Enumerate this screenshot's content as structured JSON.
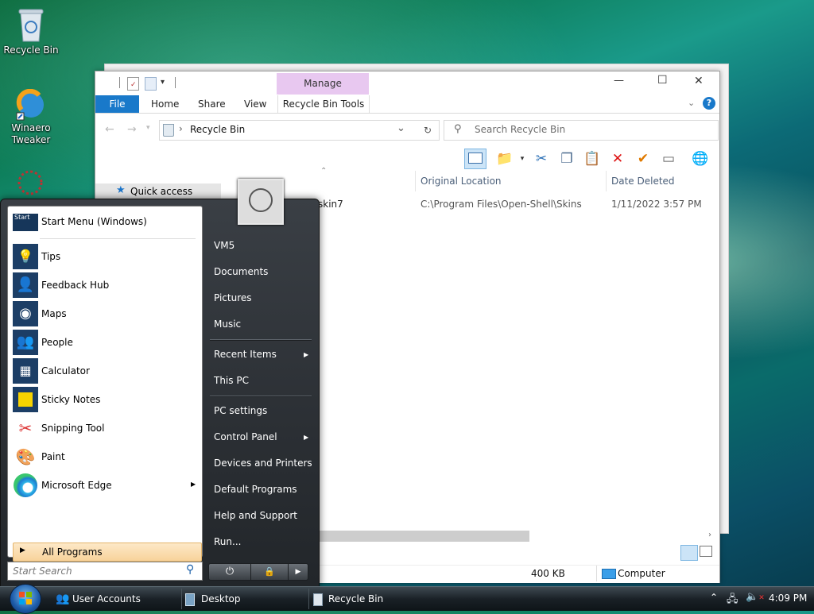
{
  "desktop": {
    "icons": [
      {
        "label": "Recycle Bin"
      },
      {
        "label": "Winaero\nTweaker"
      }
    ]
  },
  "explorer": {
    "quick_access_toolbar": [
      "properties",
      "new folder",
      "customize"
    ],
    "manage_tab": "Manage",
    "tabs": {
      "file": "File",
      "home": "Home",
      "share": "Share",
      "view": "View",
      "recycle_bin_tools": "Recycle Bin Tools"
    },
    "window_buttons": {
      "minimize": "—",
      "maximize": "☐",
      "close": "✕"
    },
    "address": {
      "path": "Recycle Bin",
      "separator": "›"
    },
    "search": {
      "placeholder": "Search Recycle Bin"
    },
    "columns": {
      "original_location": "Original Location",
      "date_deleted": "Date Deleted"
    },
    "rows": [
      {
        "name": "skin7",
        "original_location": "C:\\Program Files\\Open-Shell\\Skins",
        "date_deleted": "1/11/2022 3:57 PM"
      }
    ],
    "nav_pane": {
      "quick_access": "Quick access"
    },
    "status": {
      "size": "400 KB",
      "location": "Computer"
    }
  },
  "start_menu": {
    "pinned": [
      {
        "label": "Start Menu (Windows)",
        "icon": "start-menu-icon"
      },
      {
        "label": "Tips",
        "icon": "lightbulb-icon"
      },
      {
        "label": "Feedback Hub",
        "icon": "feedback-hub-icon"
      },
      {
        "label": "Maps",
        "icon": "maps-icon"
      },
      {
        "label": "People",
        "icon": "people-icon"
      },
      {
        "label": "Calculator",
        "icon": "calculator-icon"
      },
      {
        "label": "Sticky Notes",
        "icon": "sticky-notes-icon"
      },
      {
        "label": "Snipping Tool",
        "icon": "snipping-tool-icon"
      },
      {
        "label": "Paint",
        "icon": "paint-icon"
      },
      {
        "label": "Microsoft Edge",
        "icon": "edge-icon"
      }
    ],
    "all_programs": "All Programs",
    "search_placeholder": "Start Search",
    "right": {
      "user": "VM5",
      "documents": "Documents",
      "pictures": "Pictures",
      "music": "Music",
      "recent_items": "Recent Items",
      "this_pc": "This PC",
      "pc_settings": "PC settings",
      "control_panel": "Control Panel",
      "devices_printers": "Devices and Printers",
      "default_programs": "Default Programs",
      "help_support": "Help and Support",
      "run": "Run..."
    }
  },
  "taskbar": {
    "items": [
      {
        "label": "User Accounts"
      },
      {
        "label": "Desktop"
      },
      {
        "label": "Recycle Bin"
      }
    ],
    "clock": "4:09 PM"
  }
}
